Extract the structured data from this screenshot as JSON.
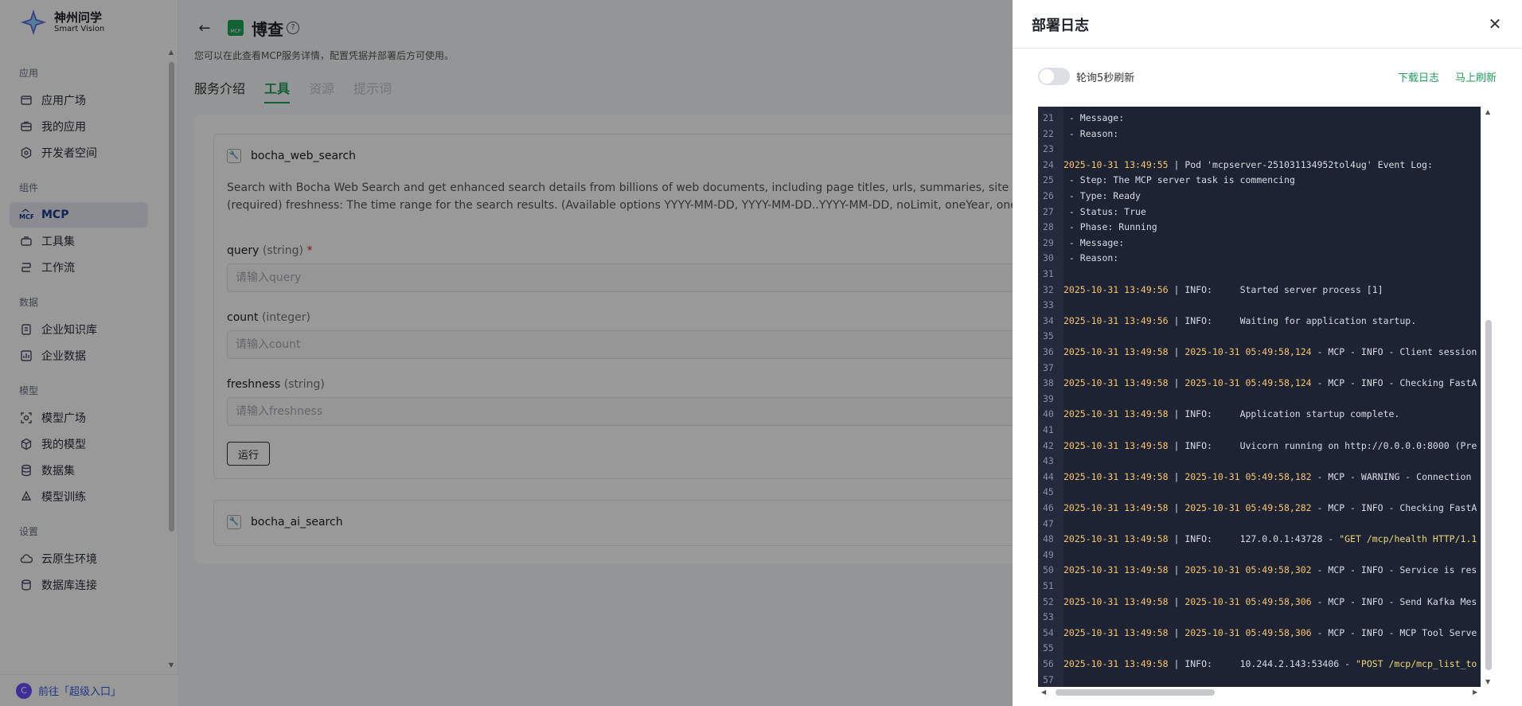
{
  "brand": {
    "name_cn": "神州问学",
    "name_en": "Smart Vision"
  },
  "sidebar": {
    "sections": [
      {
        "title": "应用",
        "items": [
          {
            "label": "应用广场",
            "icon": "app-store-icon"
          },
          {
            "label": "我的应用",
            "icon": "briefcase-icon"
          },
          {
            "label": "开发者空间",
            "icon": "dev-space-icon"
          }
        ]
      },
      {
        "title": "组件",
        "items": [
          {
            "label": "MCP",
            "icon": "mcp-icon",
            "active": true
          },
          {
            "label": "工具集",
            "icon": "toolbox-icon"
          },
          {
            "label": "工作流",
            "icon": "workflow-icon"
          }
        ]
      },
      {
        "title": "数据",
        "items": [
          {
            "label": "企业知识库",
            "icon": "knowledge-base-icon"
          },
          {
            "label": "企业数据",
            "icon": "bar-chart-icon"
          }
        ]
      },
      {
        "title": "模型",
        "items": [
          {
            "label": "模型广场",
            "icon": "model-square-icon"
          },
          {
            "label": "我的模型",
            "icon": "cube-icon"
          },
          {
            "label": "数据集",
            "icon": "database-icon"
          },
          {
            "label": "模型训练",
            "icon": "training-icon"
          }
        ]
      },
      {
        "title": "设置",
        "items": [
          {
            "label": "云原生环境",
            "icon": "cloud-icon"
          },
          {
            "label": "数据库连接",
            "icon": "db-connection-icon"
          }
        ]
      }
    ],
    "footer": {
      "avatar": "C",
      "label": "前往「超级入口」"
    }
  },
  "header": {
    "title": "博查",
    "subtitle": "您可以在此查看MCP服务详情，配置凭据并部署后方可使用。",
    "logo_text": "MCP"
  },
  "tabs": [
    {
      "label": "服务介绍",
      "state": "normal"
    },
    {
      "label": "工具",
      "state": "active"
    },
    {
      "label": "资源",
      "state": "disabled"
    },
    {
      "label": "提示词",
      "state": "disabled"
    }
  ],
  "tools": [
    {
      "name": "bocha_web_search",
      "desc_line1": "Search with Bocha Web Search and get enhanced search details from billions of web documents, including page titles, urls, summaries, site names, s",
      "desc_line2": "(required) freshness: The time range for the search results. (Available options YYYY-MM-DD, YYYY-MM-DD..YYYY-MM-DD, noLimit, oneYear, oneMonth",
      "fields": [
        {
          "name": "query",
          "type": "(string)",
          "required": "*",
          "placeholder": "请输入query"
        },
        {
          "name": "count",
          "type": "(integer)",
          "required": "",
          "placeholder": "请输入count"
        },
        {
          "name": "freshness",
          "type": "(string)",
          "required": "",
          "placeholder": "请输入freshness"
        }
      ],
      "run_label": "运行"
    },
    {
      "name": "bocha_ai_search"
    }
  ],
  "drawer": {
    "title": "部署日志",
    "close_symbol": "✕",
    "toggle_label": "轮询5秒刷新",
    "toggle_on": false,
    "download_label": "下载日志",
    "refresh_label": "马上刷新",
    "log_lines": [
      {
        "n": "21",
        "text": " - Message:"
      },
      {
        "n": "22",
        "text": " - Reason:"
      },
      {
        "n": "23",
        "text": ""
      },
      {
        "n": "24",
        "ts": "2025-10-31 13:49:55",
        "text": " | Pod 'mcpserver-251031134952tol4ug' Event Log:"
      },
      {
        "n": "25",
        "text": " - Step: The MCP server task is commencing"
      },
      {
        "n": "26",
        "text": " - Type: Ready"
      },
      {
        "n": "27",
        "text": " - Status: True"
      },
      {
        "n": "28",
        "text": " - Phase: Running"
      },
      {
        "n": "29",
        "text": " - Message:"
      },
      {
        "n": "30",
        "text": " - Reason:"
      },
      {
        "n": "31",
        "text": ""
      },
      {
        "n": "32",
        "ts": "2025-10-31 13:49:56",
        "text": " | INFO:     Started server process [1]"
      },
      {
        "n": "33",
        "text": ""
      },
      {
        "n": "34",
        "ts": "2025-10-31 13:49:56",
        "text": " | INFO:     Waiting for application startup."
      },
      {
        "n": "35",
        "text": ""
      },
      {
        "n": "36",
        "ts": "2025-10-31 13:49:58",
        "text": " | ",
        "ts2": "2025-10-31 05:49:58,124",
        "text2": " - MCP - INFO - Client session"
      },
      {
        "n": "37",
        "text": ""
      },
      {
        "n": "38",
        "ts": "2025-10-31 13:49:58",
        "text": " | ",
        "ts2": "2025-10-31 05:49:58,124",
        "text2": " - MCP - INFO - Checking FastA"
      },
      {
        "n": "39",
        "text": ""
      },
      {
        "n": "40",
        "ts": "2025-10-31 13:49:58",
        "text": " | INFO:     Application startup complete."
      },
      {
        "n": "41",
        "text": ""
      },
      {
        "n": "42",
        "ts": "2025-10-31 13:49:58",
        "text": " | INFO:     Uvicorn running on http://0.0.0.0:8000 (Pre"
      },
      {
        "n": "43",
        "text": ""
      },
      {
        "n": "44",
        "ts": "2025-10-31 13:49:58",
        "text": " | ",
        "ts2": "2025-10-31 05:49:58,182",
        "text2": " - MCP - WARNING - Connection"
      },
      {
        "n": "45",
        "text": ""
      },
      {
        "n": "46",
        "ts": "2025-10-31 13:49:58",
        "text": " | ",
        "ts2": "2025-10-31 05:49:58,282",
        "text2": " - MCP - INFO - Checking FastA"
      },
      {
        "n": "47",
        "text": ""
      },
      {
        "n": "48",
        "ts": "2025-10-31 13:49:58",
        "text": " | INFO:     127.0.0.1:43728 - ",
        "str": "\"GET /mcp/health HTTP/1.1"
      },
      {
        "n": "49",
        "text": ""
      },
      {
        "n": "50",
        "ts": "2025-10-31 13:49:58",
        "text": " | ",
        "ts2": "2025-10-31 05:49:58,302",
        "text2": " - MCP - INFO - Service is res"
      },
      {
        "n": "51",
        "text": ""
      },
      {
        "n": "52",
        "ts": "2025-10-31 13:49:58",
        "text": " | ",
        "ts2": "2025-10-31 05:49:58,306",
        "text2": " - MCP - INFO - Send Kafka Mes"
      },
      {
        "n": "53",
        "text": ""
      },
      {
        "n": "54",
        "ts": "2025-10-31 13:49:58",
        "text": " | ",
        "ts2": "2025-10-31 05:49:58,306",
        "text2": " - MCP - INFO - MCP Tool Serve"
      },
      {
        "n": "55",
        "text": ""
      },
      {
        "n": "56",
        "ts": "2025-10-31 13:49:58",
        "text": " | INFO:     10.244.2.143:53406 - ",
        "str": "\"POST /mcp/mcp_list_to"
      },
      {
        "n": "57",
        "text": ""
      }
    ]
  }
}
